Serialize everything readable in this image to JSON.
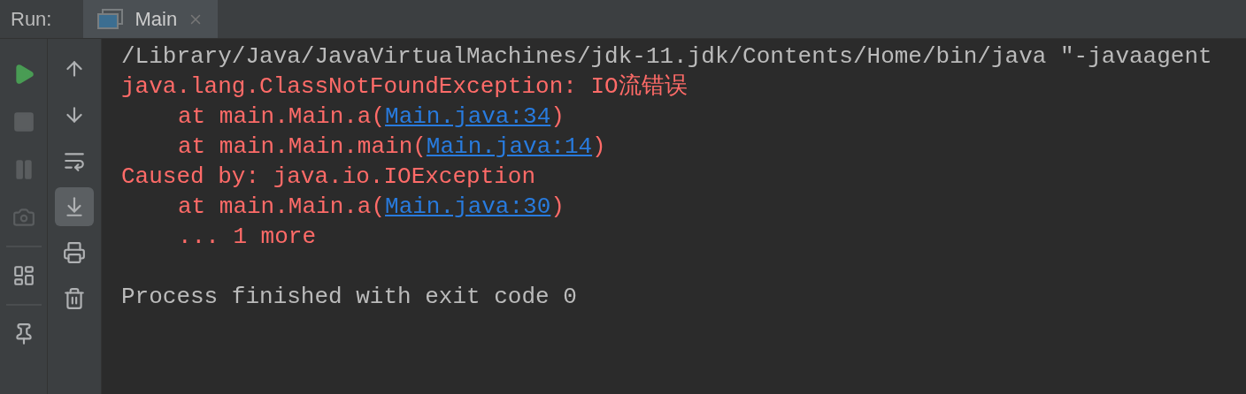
{
  "run_bar": {
    "label": "Run:",
    "tabs": [
      {
        "label": "Main",
        "selected": true
      }
    ]
  },
  "left_toolbar": [
    {
      "kind": "run",
      "disabled": false
    },
    {
      "kind": "stop",
      "disabled": true
    },
    {
      "kind": "pause",
      "disabled": true
    },
    {
      "kind": "camera",
      "disabled": true
    },
    {
      "kind": "layout",
      "disabled": false
    },
    {
      "kind": "pin",
      "disabled": false
    }
  ],
  "right_toolbar": [
    {
      "kind": "up",
      "selected": false
    },
    {
      "kind": "down",
      "selected": false
    },
    {
      "kind": "wrap",
      "selected": false
    },
    {
      "kind": "scroll-end",
      "selected": true
    },
    {
      "kind": "print",
      "selected": false
    },
    {
      "kind": "trash",
      "selected": false
    }
  ],
  "console": [
    {
      "kind": "plain",
      "parts": [
        {
          "kind": "text",
          "text": "/Library/Java/JavaVirtualMachines/jdk-11.jdk/Contents/Home/bin/java \"-javaagent"
        }
      ]
    },
    {
      "kind": "error",
      "parts": [
        {
          "kind": "text",
          "text": "java.lang.ClassNotFoundException: IO流错误"
        }
      ]
    },
    {
      "kind": "trace",
      "parts": [
        {
          "kind": "text",
          "text": "at main.Main.a("
        },
        {
          "kind": "link",
          "text": "Main.java:34"
        },
        {
          "kind": "text",
          "text": ")"
        }
      ]
    },
    {
      "kind": "trace",
      "parts": [
        {
          "kind": "text",
          "text": "at main.Main.main("
        },
        {
          "kind": "link",
          "text": "Main.java:14"
        },
        {
          "kind": "text",
          "text": ")"
        }
      ]
    },
    {
      "kind": "error",
      "parts": [
        {
          "kind": "text",
          "text": "Caused by: java.io.IOException"
        }
      ]
    },
    {
      "kind": "trace",
      "parts": [
        {
          "kind": "text",
          "text": "at main.Main.a("
        },
        {
          "kind": "link",
          "text": "Main.java:30"
        },
        {
          "kind": "text",
          "text": ")"
        }
      ]
    },
    {
      "kind": "trace",
      "parts": [
        {
          "kind": "text",
          "text": "... 1 more"
        }
      ]
    },
    {
      "kind": "blank"
    },
    {
      "kind": "plain",
      "parts": [
        {
          "kind": "text",
          "text": "Process finished with exit code 0"
        }
      ]
    }
  ]
}
